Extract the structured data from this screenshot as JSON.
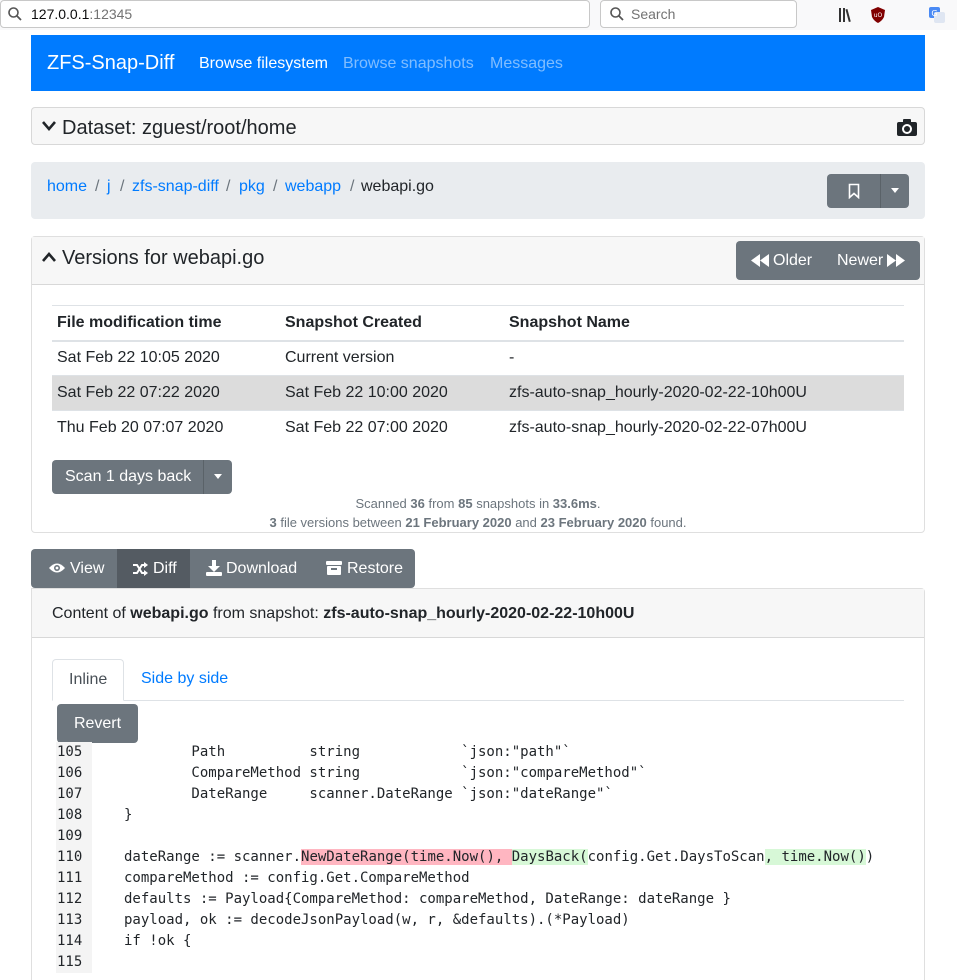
{
  "browser": {
    "url_host": "127.0.0.1",
    "url_port": ":12345",
    "search_placeholder": "Search"
  },
  "navbar": {
    "brand": "ZFS-Snap-Diff",
    "links": [
      "Browse filesystem",
      "Browse snapshots",
      "Messages"
    ]
  },
  "dataset": {
    "title": "Dataset: zguest/root/home"
  },
  "breadcrumb": {
    "items": [
      "home",
      "j",
      "zfs-snap-diff",
      "pkg",
      "webapp"
    ],
    "current": "webapi.go",
    "separator": "/"
  },
  "versions": {
    "title": "Versions for webapi.go",
    "older_label": "Older",
    "newer_label": "Newer",
    "columns": [
      "File modification time",
      "Snapshot Created",
      "Snapshot Name"
    ],
    "rows": [
      [
        "Sat Feb 22 10:05 2020",
        "Current version",
        "-"
      ],
      [
        "Sat Feb 22 07:22 2020",
        "Sat Feb 22 10:00 2020",
        "zfs-auto-snap_hourly-2020-02-22-10h00U"
      ],
      [
        "Thu Feb 20 07:07 2020",
        "Sat Feb 22 07:00 2020",
        "zfs-auto-snap_hourly-2020-02-22-07h00U"
      ]
    ],
    "selected_row": 1,
    "scan_label": "Scan 1 days back",
    "stats": {
      "scanned_prefix": "Scanned ",
      "scanned": "36",
      "from_text": " from ",
      "total": "85",
      "snapshots_text": " snapshots in ",
      "duration": "33.6ms",
      "period": ".",
      "versions_count": "3",
      "between_text": " file versions between ",
      "from_date": "21 February 2020",
      "and_text": " and ",
      "to_date": "23 February 2020",
      "found_text": " found."
    }
  },
  "actions": {
    "view": "View",
    "diff": "Diff",
    "download": "Download",
    "restore": "Restore"
  },
  "content": {
    "prefix": "Content of ",
    "file": "webapi.go",
    "middle": " from snapshot: ",
    "snapshot": "zfs-auto-snap_hourly-2020-02-22-10h00U",
    "tabs": [
      "Inline",
      "Side by side"
    ],
    "revert_label": "Revert"
  },
  "code": {
    "lines": [
      {
        "num": "105",
        "text": "        Path          string            `json:\"path\"`"
      },
      {
        "num": "106",
        "text": "        CompareMethod string            `json:\"compareMethod\"`"
      },
      {
        "num": "107",
        "text": "        DateRange     scanner.DateRange `json:\"dateRange\"`"
      },
      {
        "num": "108",
        "text": "}"
      },
      {
        "num": "109",
        "text": ""
      },
      {
        "num": "110",
        "parts": [
          {
            "t": "dateRange := scanner.",
            "k": ""
          },
          {
            "t": "NewDateRange(time.Now(), ",
            "k": "del"
          },
          {
            "t": "DaysBack(",
            "k": "ins"
          },
          {
            "t": "config.Get.DaysToScan",
            "k": ""
          },
          {
            "t": ", time.Now()",
            "k": "ins"
          },
          {
            "t": ")",
            "k": ""
          }
        ]
      },
      {
        "num": "111",
        "text": "compareMethod := config.Get.CompareMethod"
      },
      {
        "num": "112",
        "text": "defaults := Payload{CompareMethod: compareMethod, DateRange: dateRange }"
      },
      {
        "num": "113",
        "text": "payload, ok := decodeJsonPayload(w, r, &defaults).(*Payload)"
      },
      {
        "num": "114",
        "text": "if !ok {"
      },
      {
        "num": "115",
        "text": ""
      }
    ]
  },
  "colors": {
    "primary": "#007bff",
    "secondary": "#6c757d",
    "deleted": "#ffb6c1",
    "inserted": "#d7f8d7"
  }
}
